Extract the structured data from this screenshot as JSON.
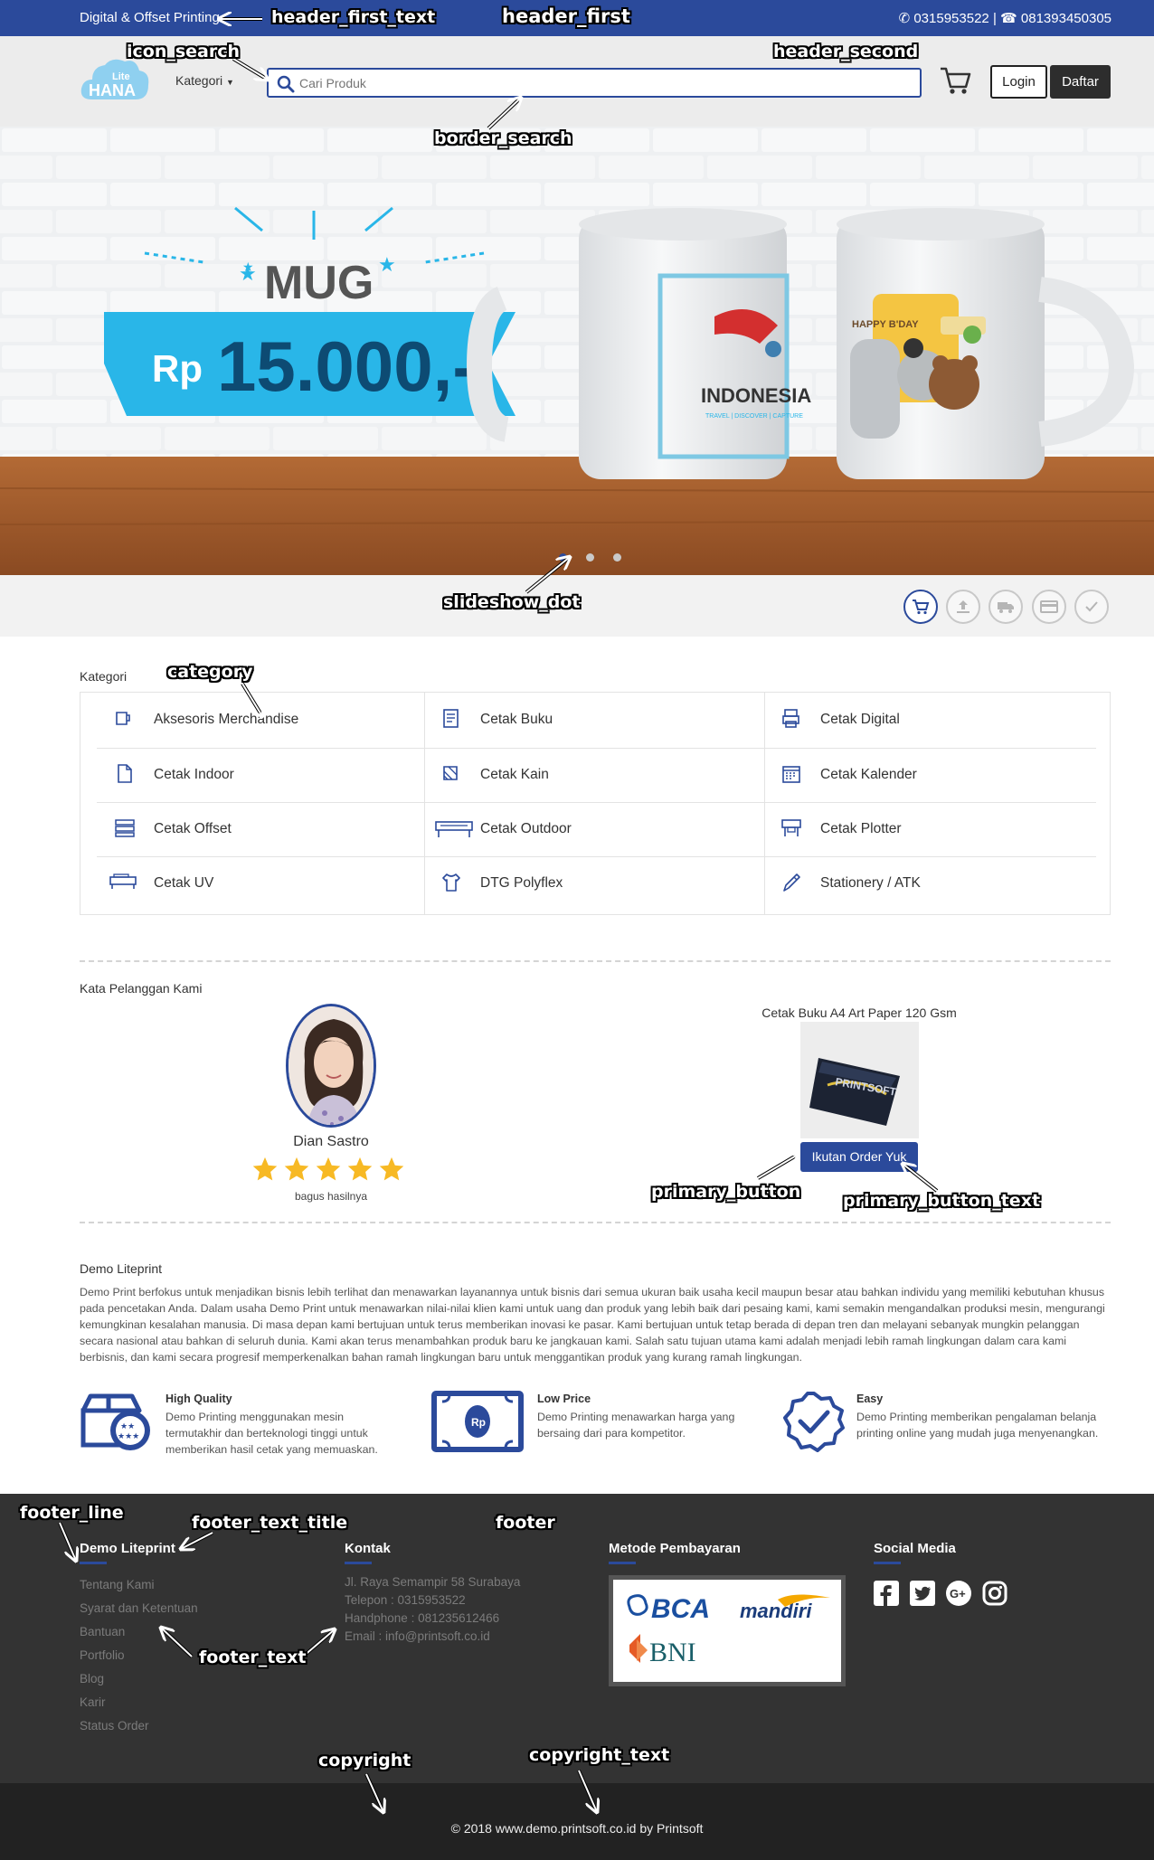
{
  "header_first": {
    "left_text": "Digital & Offset Printing",
    "phone": "0315953522",
    "separator": "|",
    "whatsapp": "081393450305"
  },
  "header_second": {
    "logo_small": "Lite",
    "logo_big": "HANA",
    "kategori_label": "Kategori",
    "search_placeholder": "Cari Produk",
    "login_label": "Login",
    "daftar_label": "Daftar"
  },
  "hero": {
    "product": "MUG",
    "price": "Rp 15.000,-",
    "price_prefix": "Rp",
    "price_value": "15.000,-",
    "mug_text_left": "INDONESIA",
    "mug_text_left_sub": "TRAVEL | DISCOVER | CAPTURE",
    "mug_text_right": "HAPPY B'DAY",
    "slides": 3,
    "active_slide": 1
  },
  "steps": [
    "cart-icon",
    "upload-icon",
    "truck-icon",
    "card-icon",
    "check-icon"
  ],
  "category": {
    "title": "Kategori",
    "items": [
      {
        "label": "Aksesoris Merchandise",
        "icon": "mug-icon"
      },
      {
        "label": "Cetak Buku",
        "icon": "book-icon"
      },
      {
        "label": "Cetak Digital",
        "icon": "printer-icon"
      },
      {
        "label": "Cetak Indoor",
        "icon": "document-icon"
      },
      {
        "label": "Cetak Kain",
        "icon": "fabric-icon"
      },
      {
        "label": "Cetak Kalender",
        "icon": "calendar-icon"
      },
      {
        "label": "Cetak Offset",
        "icon": "offset-press-icon"
      },
      {
        "label": "Cetak Outdoor",
        "icon": "outdoor-printer-icon"
      },
      {
        "label": "Cetak Plotter",
        "icon": "plotter-icon"
      },
      {
        "label": "Cetak UV",
        "icon": "uv-printer-icon"
      },
      {
        "label": "DTG Polyflex",
        "icon": "tshirt-icon"
      },
      {
        "label": "Stationery / ATK",
        "icon": "pen-icon"
      }
    ]
  },
  "testimonial": {
    "title": "Kata Pelanggan Kami",
    "name": "Dian Sastro",
    "rating": 5,
    "comment": "bagus hasilnya",
    "product_title": "Cetak Buku A4 Art Paper 120 Gsm",
    "product_image_text": "PRINTSOFT",
    "button_label": "Ikutan Order Yuk"
  },
  "about": {
    "title": "Demo Liteprint",
    "text": "Demo Print berfokus untuk menjadikan bisnis lebih terlihat dan menawarkan layanannya untuk bisnis dari semua ukuran baik usaha kecil maupun besar atau bahkan individu yang memiliki kebutuhan khusus pada pencetakan Anda. Dalam usaha Demo Print untuk menawarkan nilai-nilai klien kami untuk uang dan produk yang lebih baik dari pesaing kami, kami semakin mengandalkan produksi mesin, mengurangi kemungkinan kesalahan manusia. Di masa depan kami bertujuan untuk terus memberikan inovasi ke pasar. Kami bertujuan untuk tetap berada di depan tren dan melayani sebanyak mungkin pelanggan secara nasional atau bahkan di seluruh dunia. Kami akan terus menambahkan produk baru ke jangkauan kami. Salah satu tujuan utama kami adalah menjadi lebih ramah lingkungan dalam cara kami berbisnis, dan kami secara progresif memperkenalkan bahan ramah lingkungan baru untuk menggantikan produk yang kurang ramah lingkungan.",
    "features": [
      {
        "title": "High Quality",
        "desc": "Demo Printing menggunakan mesin termutakhir dan berteknologi tinggi untuk memberikan hasil cetak yang memuaskan.",
        "icon": "quality-box-icon"
      },
      {
        "title": "Low Price",
        "desc": "Demo Printing menawarkan harga yang bersaing dari para kompetitor.",
        "icon": "money-icon",
        "icon_text": "Rp"
      },
      {
        "title": "Easy",
        "desc": "Demo Printing memberikan pengalaman belanja printing online yang mudah juga menyenangkan.",
        "icon": "check-badge-icon"
      }
    ]
  },
  "footer": {
    "col1_title": "Demo Liteprint",
    "col1_links": [
      "Tentang Kami",
      "Syarat dan Ketentuan",
      "Bantuan",
      "Portfolio",
      "Blog",
      "Karir",
      "Status Order"
    ],
    "col2_title": "Kontak",
    "col2_lines": [
      "Jl. Raya Semampir 58 Surabaya",
      "Telepon : 0315953522",
      "Handphone : 081235612466",
      "Email : info@printsoft.co.id"
    ],
    "col3_title": "Metode Pembayaran",
    "banks": [
      "BCA",
      "mandiri",
      "BNI"
    ],
    "col4_title": "Social Media",
    "social": [
      "facebook-icon",
      "twitter-icon",
      "google-plus-icon",
      "instagram-icon"
    ]
  },
  "copyright": "© 2018 www.demo.printsoft.co.id by Printsoft",
  "annotations": {
    "header_first_text": "header_first_text",
    "header_first": "header_first",
    "icon_search": "icon_search",
    "header_second": "header_second",
    "border_search": "border_search",
    "slideshow_dot": "slideshow_dot",
    "category": "category",
    "primary_button": "primary_button",
    "primary_button_text": "primary_button_text",
    "footer_line": "footer_line",
    "footer_text_title": "footer_text_title",
    "footer": "footer",
    "footer_text": "footer_text",
    "copyright": "copyright",
    "copyright_text": "copyright_text"
  },
  "colors": {
    "primary": "#2b4a9b",
    "footer_bg": "#333333",
    "copyright_bg": "#222222",
    "star": "#f7b924",
    "hero_ribbon": "#29b6e8"
  }
}
